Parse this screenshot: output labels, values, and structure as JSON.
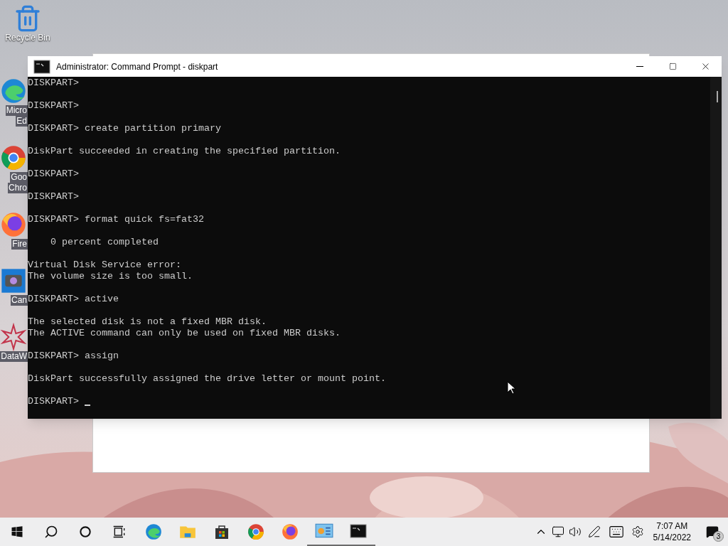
{
  "desktop_icons": [
    {
      "kind": "recycle",
      "lines": [
        "Recycle Bin"
      ]
    },
    {
      "kind": "edge",
      "lines": [
        "Micro",
        "Ed"
      ]
    },
    {
      "kind": "chrome",
      "lines": [
        "Goo",
        "Chro"
      ]
    },
    {
      "kind": "firefox",
      "lines": [
        "Fire"
      ]
    },
    {
      "kind": "camera",
      "lines": [
        "Can"
      ]
    },
    {
      "kind": "star",
      "lines": [
        "DataW"
      ]
    }
  ],
  "window": {
    "title": "Administrator: Command Prompt - diskpart",
    "console": [
      "DISKPART>",
      "DISKPART>",
      "DISKPART> create partition primary",
      "DiskPart succeeded in creating the specified partition.",
      "DISKPART>",
      "DISKPART>",
      "DISKPART> format quick fs=fat32",
      "    0 percent completed",
      "Virtual Disk Service error:\nThe volume size is too small.\n",
      "DISKPART> active",
      "The selected disk is not a fixed MBR disk.\nThe ACTIVE command can only be used on fixed MBR disks.",
      "DISKPART> assign",
      "DiskPart successfully assigned the drive letter or mount point.",
      "DISKPART> "
    ]
  },
  "taskbar": {
    "items": [
      {
        "kind": "start",
        "active": false
      },
      {
        "kind": "search",
        "active": false
      },
      {
        "kind": "cortana",
        "active": false
      },
      {
        "kind": "taskview",
        "active": false
      },
      {
        "kind": "edge",
        "active": false
      },
      {
        "kind": "explorer",
        "active": false
      },
      {
        "kind": "store",
        "active": false
      },
      {
        "kind": "chrome",
        "active": false
      },
      {
        "kind": "firefox",
        "active": false
      },
      {
        "kind": "controlpanel",
        "active": true
      },
      {
        "kind": "cmd",
        "active": true
      }
    ],
    "time": "7:07 AM",
    "date": "5/14/2022",
    "notifications": "3"
  }
}
